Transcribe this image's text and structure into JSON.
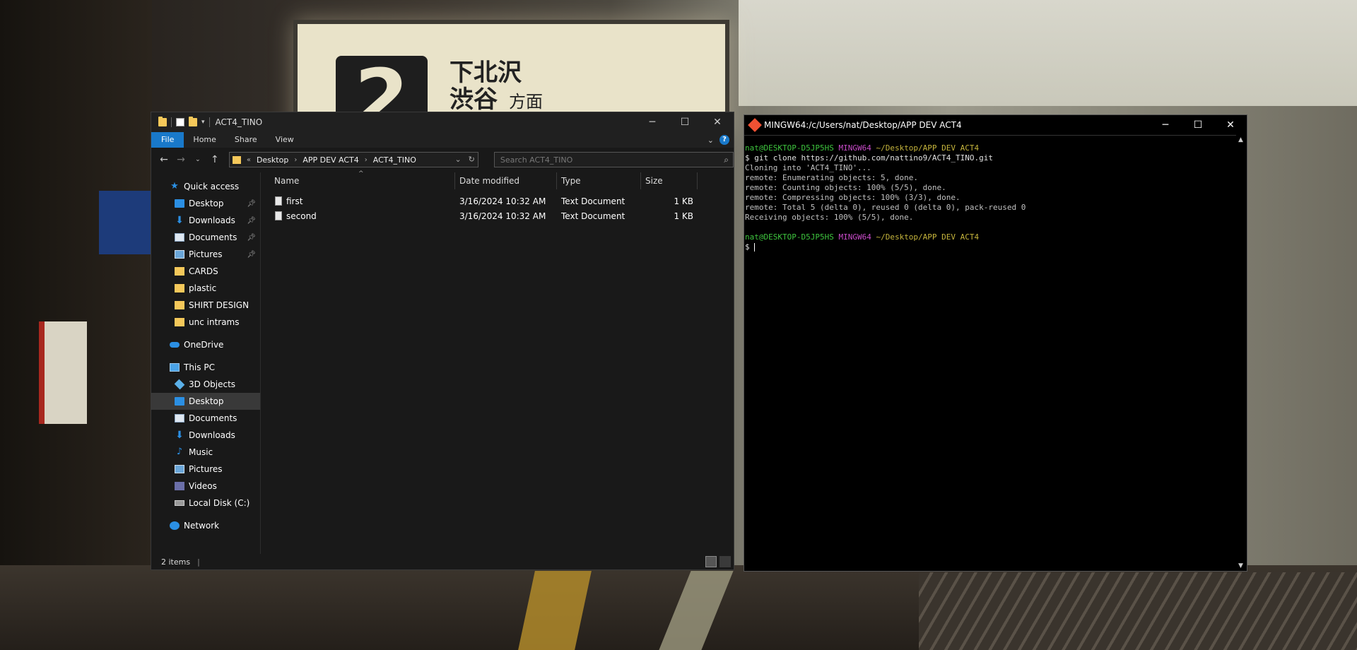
{
  "explorer": {
    "title": "ACT4_TINO",
    "ribbon_tabs": [
      "File",
      "Home",
      "Share",
      "View"
    ],
    "breadcrumb": {
      "prefix": "«",
      "parts": [
        "Desktop",
        "APP DEV ACT4",
        "ACT4_TINO"
      ]
    },
    "search_placeholder": "Search ACT4_TINO",
    "nav": {
      "quick_access": "Quick access",
      "quick_items": [
        "Desktop",
        "Downloads",
        "Documents",
        "Pictures",
        "CARDS",
        "plastic",
        "SHIRT DESIGN",
        "unc intrams"
      ],
      "onedrive": "OneDrive",
      "this_pc": "This PC",
      "pc_items": [
        "3D Objects",
        "Desktop",
        "Documents",
        "Downloads",
        "Music",
        "Pictures",
        "Videos",
        "Local Disk (C:)"
      ],
      "network": "Network"
    },
    "columns": {
      "name": "Name",
      "date": "Date modified",
      "type": "Type",
      "size": "Size"
    },
    "files": [
      {
        "name": "first",
        "date": "3/16/2024 10:32 AM",
        "type": "Text Document",
        "size": "1 KB"
      },
      {
        "name": "second",
        "date": "3/16/2024 10:32 AM",
        "type": "Text Document",
        "size": "1 KB"
      }
    ],
    "status": "2 items"
  },
  "terminal": {
    "title": "MINGW64:/c/Users/nat/Desktop/APP DEV ACT4",
    "prompt_user": "nat@DESKTOP-D5JP5HS",
    "prompt_env": "MINGW64",
    "prompt_path": "~/Desktop/APP DEV ACT4",
    "command": "$ git clone https://github.com/nattino9/ACT4_TINO.git",
    "output": [
      "Cloning into 'ACT4_TINO'...",
      "remote: Enumerating objects: 5, done.",
      "remote: Counting objects: 100% (5/5), done.",
      "remote: Compressing objects: 100% (3/3), done.",
      "remote: Total 5 (delta 0), reused 0 (delta 0), pack-reused 0",
      "Receiving objects: 100% (5/5), done."
    ],
    "prompt_symbol": "$"
  },
  "wallpaper": {
    "sign_number": "2",
    "sign_line1": "下北沢",
    "sign_line2": "渋谷",
    "sign_suffix": "方面"
  },
  "colors": {
    "accent": "#1979ca",
    "prompt_green": "#3ec43e",
    "prompt_magenta": "#c84bc8",
    "prompt_yellow": "#c5b43c"
  }
}
